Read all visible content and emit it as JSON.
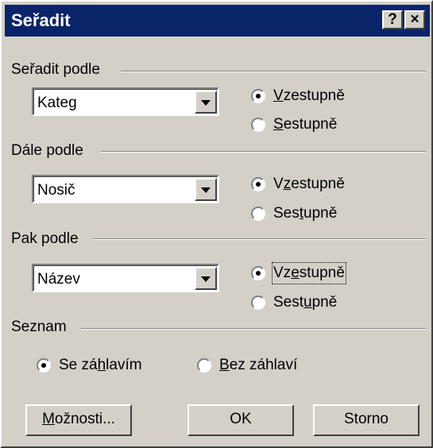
{
  "window": {
    "title": "Seřadit",
    "help_label": "?",
    "close_label": "×"
  },
  "groups": [
    {
      "label": "Seřadit podle",
      "combo_value": "Kateg",
      "asc": {
        "pre": "",
        "key": "V",
        "post": "zestupně",
        "checked": true
      },
      "desc": {
        "pre": "",
        "key": "S",
        "post": "estupně",
        "checked": false
      }
    },
    {
      "label": "Dále podle",
      "combo_value": "Nosič",
      "asc": {
        "pre": "V",
        "key": "z",
        "post": "estupně",
        "checked": true
      },
      "desc": {
        "pre": "Ses",
        "key": "t",
        "post": "upně",
        "checked": false
      }
    },
    {
      "label": "Pak podle",
      "combo_value": "Název",
      "asc": {
        "pre": "Vz",
        "key": "e",
        "post": "stupně",
        "checked": true
      },
      "desc": {
        "pre": "Sest",
        "key": "u",
        "post": "pně",
        "checked": false
      }
    }
  ],
  "list_section": {
    "label": "Seznam",
    "with_header": {
      "pre": "Se zá",
      "key": "h",
      "post": "lavím",
      "checked": true
    },
    "without_header": {
      "pre": "",
      "key": "B",
      "post": "ez záhlaví",
      "checked": false
    }
  },
  "buttons": {
    "options": {
      "pre": "",
      "key": "M",
      "post": "ožnosti..."
    },
    "ok": "OK",
    "cancel": "Storno"
  }
}
